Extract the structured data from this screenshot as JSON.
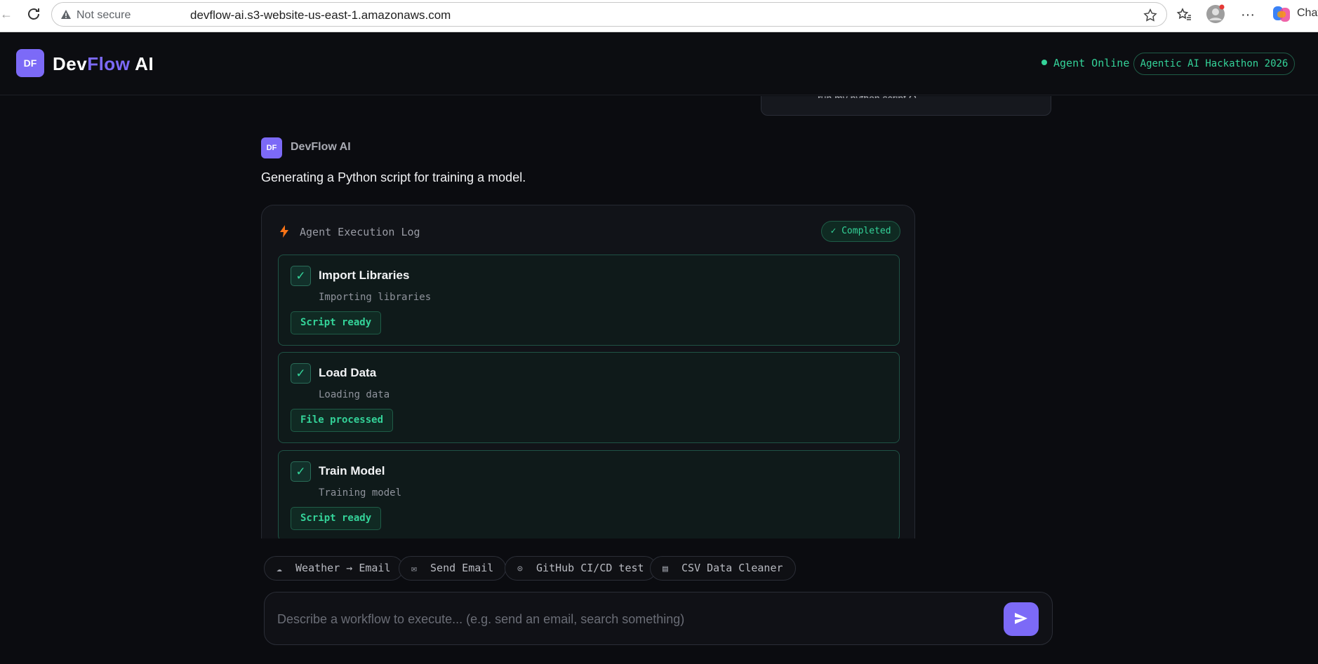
{
  "browser": {
    "security_label": "Not secure",
    "url": "devflow-ai.s3-website-us-east-1.amazonaws.com",
    "chat_label": "Chat",
    "more_label": "···"
  },
  "header": {
    "badge": "DF",
    "brand_dev": "Dev",
    "brand_flow": "Flow",
    "brand_ai": " AI",
    "status": "Agent Online",
    "event_pill": "Agentic AI Hackathon 2026"
  },
  "conversation": {
    "previous_user_message": "run my python script Q",
    "assistant": {
      "avatar": "DF",
      "name": "DevFlow AI",
      "message": "Generating a Python script for training a model."
    }
  },
  "execution_log": {
    "title": "Agent Execution Log",
    "status": "✓ Completed",
    "steps": [
      {
        "check": "✓",
        "title": "Import Libraries",
        "description": "Importing libraries",
        "result": "Script ready"
      },
      {
        "check": "✓",
        "title": "Load Data",
        "description": "Loading data",
        "result": "File processed"
      },
      {
        "check": "✓",
        "title": "Train Model",
        "description": "Training model",
        "result": "Script ready"
      }
    ]
  },
  "quick_actions": [
    {
      "icon": "☁",
      "label": "Weather → Email"
    },
    {
      "icon": "✉",
      "label": "Send Email"
    },
    {
      "icon": "⊙",
      "label": "GitHub CI/CD test"
    },
    {
      "icon": "▤",
      "label": "CSV Data Cleaner"
    }
  ],
  "composer": {
    "placeholder": "Describe a workflow to execute... (e.g. send an email, search something)"
  },
  "colors": {
    "accent": "#7c6af7",
    "success": "#34d399",
    "background": "#0b0c10"
  }
}
